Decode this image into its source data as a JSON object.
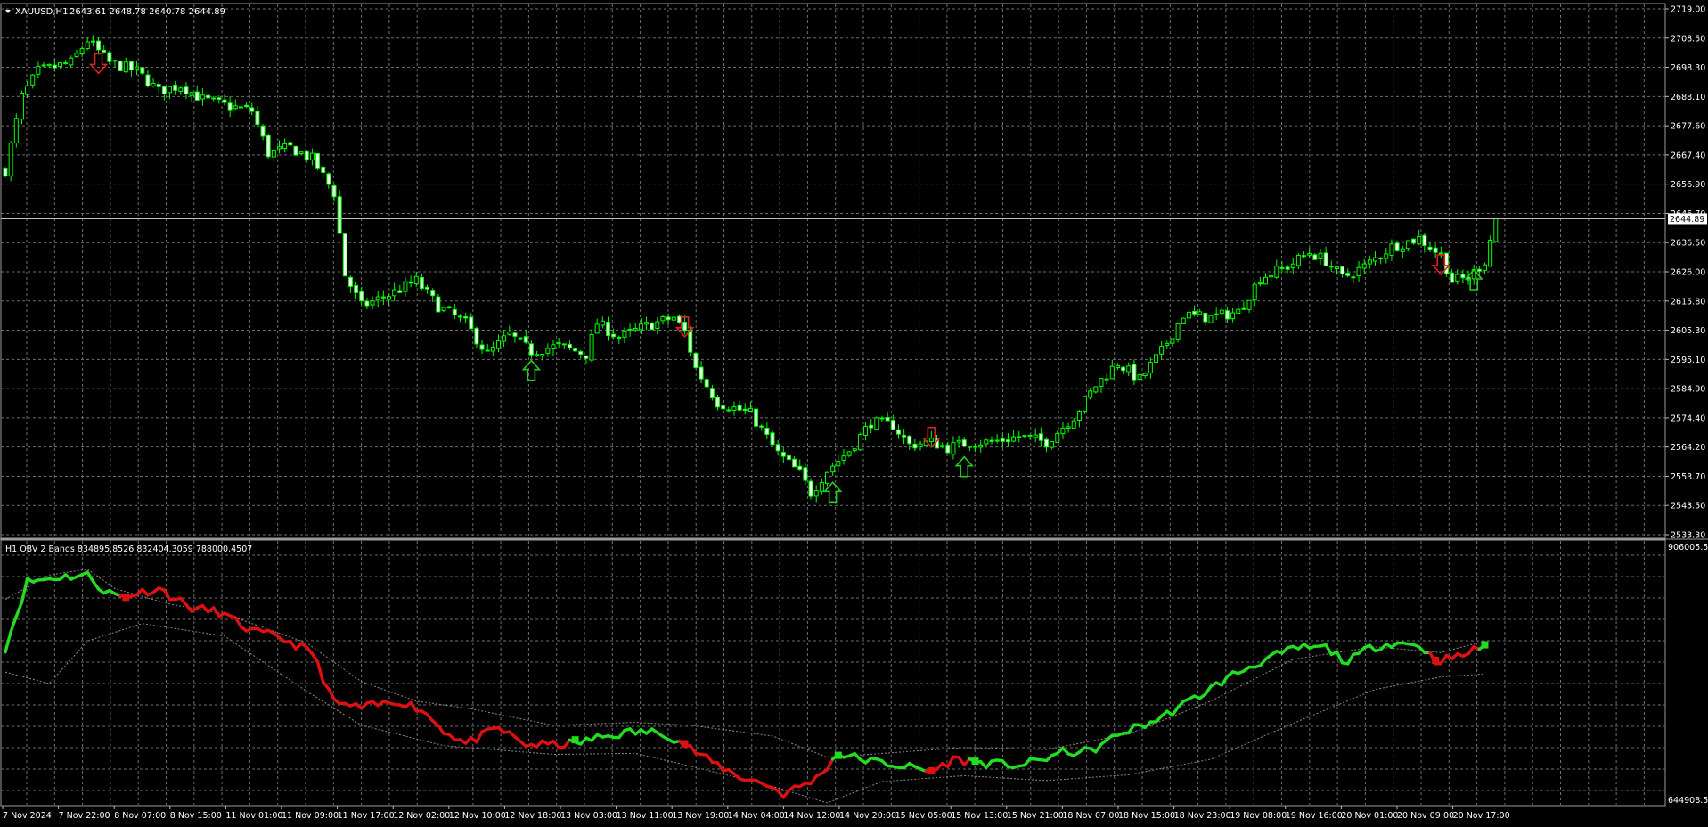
{
  "price_panel": {
    "symbol_label": "XAUUSD,H1",
    "ohlc_text": "2643.61 2648.78 2640.78 2644.89",
    "price_ticks": [
      "2719.00",
      "2708.50",
      "2698.30",
      "2688.10",
      "2677.60",
      "2667.40",
      "2656.90",
      "2646.70",
      "2636.50",
      "2626.00",
      "2615.80",
      "2605.30",
      "2595.10",
      "2584.90",
      "2574.40",
      "2564.20",
      "2553.70",
      "2543.50",
      "2533.30"
    ],
    "current_price_label": "2644.89"
  },
  "indicator_panel": {
    "label": "H1 OBV 2 Bands 834895.8526 832404.3059 788000.4507",
    "scale_top": "906005.55",
    "scale_bottom": "644908.53"
  },
  "time_axis": {
    "labels": [
      "7 Nov 2024",
      "7 Nov 22:00",
      "8 Nov 07:00",
      "8 Nov 15:00",
      "11 Nov 01:00",
      "11 Nov 09:00",
      "11 Nov 17:00",
      "12 Nov 02:00",
      "12 Nov 10:00",
      "12 Nov 18:00",
      "13 Nov 03:00",
      "13 Nov 11:00",
      "13 Nov 19:00",
      "14 Nov 04:00",
      "14 Nov 12:00",
      "14 Nov 20:00",
      "15 Nov 05:00",
      "15 Nov 13:00",
      "15 Nov 21:00",
      "18 Nov 07:00",
      "18 Nov 15:00",
      "18 Nov 23:00",
      "19 Nov 08:00",
      "19 Nov 16:00",
      "20 Nov 01:00",
      "20 Nov 09:00",
      "20 Nov 17:00"
    ]
  },
  "colors": {
    "background": "#000000",
    "grid": "#6e6e6e",
    "candle": "#00ff00",
    "obv_up": "#22dd22",
    "obv_down": "#dd1111",
    "band": "#8a8a8a",
    "buy_arrow": "#22cc22",
    "sell_arrow": "#dd2222",
    "text": "#ffffff"
  },
  "chart_data": [
    {
      "type": "candlestick",
      "title": "XAUUSD,H1",
      "ylim": [
        2533.3,
        2719.0
      ],
      "anchors": [
        [
          0,
          2662
        ],
        [
          3,
          2688
        ],
        [
          6,
          2697
        ],
        [
          12,
          2700
        ],
        [
          15,
          2708
        ],
        [
          19,
          2700
        ],
        [
          24,
          2697
        ],
        [
          28,
          2690
        ],
        [
          32,
          2692
        ],
        [
          36,
          2687
        ],
        [
          40,
          2685
        ],
        [
          45,
          2683
        ],
        [
          48,
          2668
        ],
        [
          52,
          2670
        ],
        [
          56,
          2666
        ],
        [
          60,
          2654
        ],
        [
          62,
          2625
        ],
        [
          65,
          2614
        ],
        [
          70,
          2618
        ],
        [
          75,
          2623
        ],
        [
          79,
          2614
        ],
        [
          84,
          2608
        ],
        [
          88,
          2597
        ],
        [
          92,
          2604
        ],
        [
          96,
          2598
        ],
        [
          101,
          2600
        ],
        [
          106,
          2597
        ],
        [
          108,
          2608
        ],
        [
          112,
          2603
        ],
        [
          117,
          2607
        ],
        [
          122,
          2610
        ],
        [
          124,
          2605
        ],
        [
          126,
          2592
        ],
        [
          130,
          2580
        ],
        [
          136,
          2576
        ],
        [
          141,
          2562
        ],
        [
          145,
          2555
        ],
        [
          147,
          2548
        ],
        [
          150,
          2556
        ],
        [
          154,
          2563
        ],
        [
          158,
          2573
        ],
        [
          162,
          2572
        ],
        [
          165,
          2565
        ],
        [
          169,
          2566
        ],
        [
          172,
          2564
        ],
        [
          176,
          2566
        ],
        [
          180,
          2566
        ],
        [
          185,
          2568
        ],
        [
          190,
          2566
        ],
        [
          195,
          2575
        ],
        [
          199,
          2586
        ],
        [
          203,
          2594
        ],
        [
          207,
          2588
        ],
        [
          211,
          2598
        ],
        [
          215,
          2611
        ],
        [
          220,
          2610
        ],
        [
          225,
          2612
        ],
        [
          229,
          2624
        ],
        [
          234,
          2628
        ],
        [
          238,
          2633
        ],
        [
          241,
          2630
        ],
        [
          244,
          2624
        ],
        [
          248,
          2628
        ],
        [
          253,
          2635
        ],
        [
          258,
          2638
        ],
        [
          262,
          2632
        ],
        [
          264,
          2623
        ],
        [
          267,
          2624
        ],
        [
          270,
          2630
        ],
        [
          272,
          2645
        ]
      ],
      "signals": [
        {
          "index": 17,
          "type": "sell",
          "price": 2700
        },
        {
          "index": 96,
          "type": "buy",
          "price": 2591
        },
        {
          "index": 124,
          "type": "sell",
          "price": 2607
        },
        {
          "index": 151,
          "type": "buy",
          "price": 2548
        },
        {
          "index": 169,
          "type": "sell",
          "price": 2568
        },
        {
          "index": 175,
          "type": "buy",
          "price": 2557
        },
        {
          "index": 262,
          "type": "sell",
          "price": 2629
        },
        {
          "index": 268,
          "type": "buy",
          "price": 2623
        }
      ],
      "last_price": 2644.89
    },
    {
      "type": "line",
      "title": "H1 OBV 2 Bands",
      "ylim": [
        644908.53,
        906005.55
      ],
      "obv_anchors": [
        [
          0,
          805000
        ],
        [
          4,
          873000
        ],
        [
          10,
          878000
        ],
        [
          15,
          880000
        ],
        [
          18,
          864000
        ],
        [
          21,
          858000
        ],
        [
          28,
          866000
        ],
        [
          34,
          846000
        ],
        [
          39,
          842000
        ],
        [
          45,
          822000
        ],
        [
          50,
          816000
        ],
        [
          56,
          800000
        ],
        [
          60,
          748000
        ],
        [
          65,
          743000
        ],
        [
          72,
          750000
        ],
        [
          76,
          741000
        ],
        [
          80,
          720000
        ],
        [
          84,
          706000
        ],
        [
          90,
          722000
        ],
        [
          95,
          705000
        ],
        [
          100,
          705000
        ],
        [
          104,
          706000
        ],
        [
          108,
          712000
        ],
        [
          114,
          718000
        ],
        [
          120,
          718000
        ],
        [
          124,
          705000
        ],
        [
          128,
          690000
        ],
        [
          134,
          672000
        ],
        [
          139,
          664000
        ],
        [
          142,
          654000
        ],
        [
          148,
          670000
        ],
        [
          152,
          696000
        ],
        [
          158,
          688000
        ],
        [
          165,
          682000
        ],
        [
          169,
          677000
        ],
        [
          173,
          690000
        ],
        [
          180,
          685000
        ],
        [
          186,
          684000
        ],
        [
          193,
          697000
        ],
        [
          198,
          698000
        ],
        [
          204,
          718000
        ],
        [
          210,
          730000
        ],
        [
          218,
          756000
        ],
        [
          224,
          777000
        ],
        [
          230,
          793000
        ],
        [
          236,
          805000
        ],
        [
          241,
          805000
        ],
        [
          245,
          790000
        ],
        [
          249,
          805000
        ],
        [
          253,
          810000
        ],
        [
          258,
          808000
        ],
        [
          261,
          792000
        ],
        [
          265,
          795000
        ],
        [
          270,
          808000
        ]
      ],
      "band_upper_anchors": [
        [
          0,
          855000
        ],
        [
          8,
          880000
        ],
        [
          15,
          886000
        ],
        [
          20,
          866000
        ],
        [
          30,
          850000
        ],
        [
          40,
          840000
        ],
        [
          55,
          810000
        ],
        [
          65,
          770000
        ],
        [
          75,
          750000
        ],
        [
          85,
          742000
        ],
        [
          100,
          725000
        ],
        [
          115,
          728000
        ],
        [
          125,
          725000
        ],
        [
          140,
          714000
        ],
        [
          150,
          692000
        ],
        [
          160,
          696000
        ],
        [
          175,
          702000
        ],
        [
          190,
          700000
        ],
        [
          205,
          716000
        ],
        [
          220,
          750000
        ],
        [
          235,
          793000
        ],
        [
          250,
          806000
        ],
        [
          262,
          800000
        ],
        [
          270,
          812000
        ]
      ],
      "band_lower_anchors": [
        [
          0,
          780000
        ],
        [
          8,
          768000
        ],
        [
          15,
          812000
        ],
        [
          25,
          830000
        ],
        [
          40,
          817000
        ],
        [
          55,
          760000
        ],
        [
          65,
          725000
        ],
        [
          80,
          704000
        ],
        [
          100,
          695000
        ],
        [
          115,
          696000
        ],
        [
          125,
          683000
        ],
        [
          140,
          662000
        ],
        [
          150,
          645000
        ],
        [
          160,
          667000
        ],
        [
          175,
          673000
        ],
        [
          190,
          668000
        ],
        [
          205,
          674000
        ],
        [
          220,
          690000
        ],
        [
          235,
          727000
        ],
        [
          250,
          762000
        ],
        [
          262,
          775000
        ],
        [
          270,
          778000
        ]
      ],
      "color_changes": [
        {
          "index": 22,
          "color": "down",
          "value": 857000
        },
        {
          "index": 104,
          "color": "up",
          "value": 710000
        },
        {
          "index": 124,
          "color": "down",
          "value": 706000
        },
        {
          "index": 152,
          "color": "up",
          "value": 694000
        },
        {
          "index": 169,
          "color": "down",
          "value": 678000
        },
        {
          "index": 177,
          "color": "up",
          "value": 688000
        },
        {
          "index": 261,
          "color": "down",
          "value": 792000
        },
        {
          "index": 270,
          "color": "up",
          "value": 808000
        }
      ]
    }
  ]
}
